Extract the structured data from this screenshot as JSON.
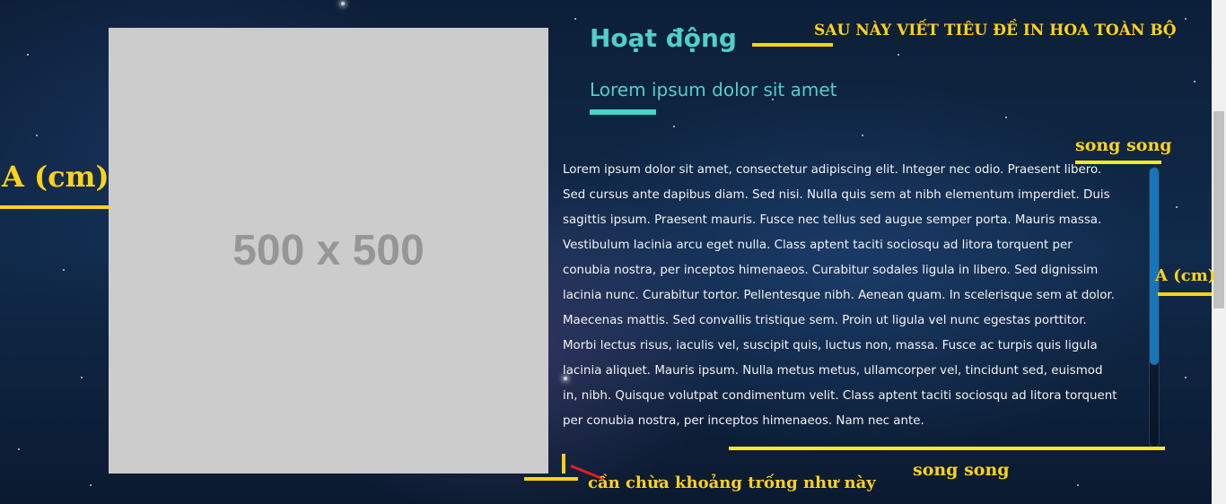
{
  "image_placeholder": {
    "label": "500 x 500"
  },
  "section": {
    "title": "Hoạt động",
    "subtitle": "Lorem ipsum dolor sit amet",
    "body": "Lorem ipsum dolor sit amet, consectetur adipiscing elit. Integer nec odio. Praesent libero. Sed cursus ante dapibus diam. Sed nisi. Nulla quis sem at nibh elementum imperdiet. Duis sagittis ipsum. Praesent mauris. Fusce nec tellus sed augue semper porta. Mauris massa. Vestibulum lacinia arcu eget nulla. Class aptent taciti sociosqu ad litora torquent per conubia nostra, per inceptos himenaeos. Curabitur sodales ligula in libero. Sed dignissim lacinia nunc. Curabitur tortor. Pellentesque nibh. Aenean quam. In scelerisque sem at dolor. Maecenas mattis. Sed convallis tristique sem. Proin ut ligula vel nunc egestas porttitor. Morbi lectus risus, iaculis vel, suscipit quis, luctus non, massa. Fusce ac turpis quis ligula lacinia aliquet. Mauris ipsum. Nulla metus metus, ullamcorper vel, tincidunt sed, euismod in, nibh. Quisque volutpat condimentum velit. Class aptent taciti sociosqu ad litora torquent per conubia nostra, per inceptos himenaeos. Nam nec ante."
  },
  "annotations": {
    "title_note": "SAU NÀY VIẾT TIÊU ĐỀ IN HOA TOÀN BỘ",
    "left_dimension": "A (cm)",
    "right_dimension": "A (cm)",
    "parallel_top": "song song",
    "parallel_bottom": "song song",
    "spacing_note": "cần chừa khoảng trống như này"
  },
  "colors": {
    "accent": "#4fd0c8",
    "annotation": "#ffd21a",
    "scroll_thumb": "#1a74b8",
    "placeholder_bg": "#cccccc"
  }
}
